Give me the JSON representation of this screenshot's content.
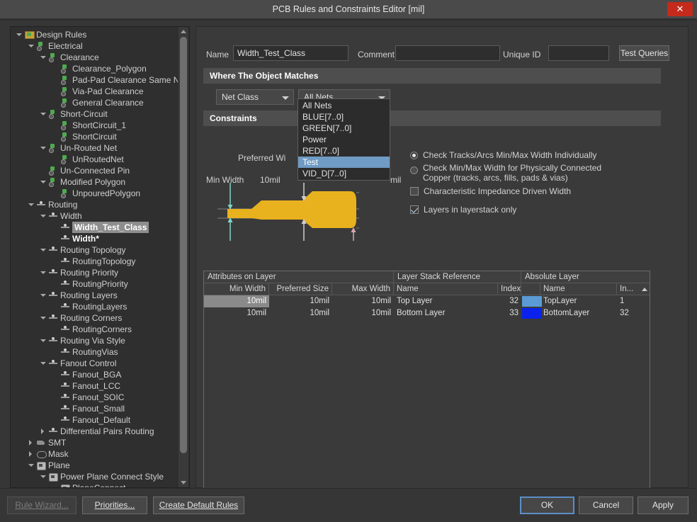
{
  "window": {
    "title": "PCB Rules and Constraints Editor [mil]",
    "close_label": "✕",
    "close_icon": "close-icon",
    "accent_close": "#c42b1c"
  },
  "tree": {
    "scrollbar": {
      "up_icon": "chevron-up-icon",
      "down_icon": "chevron-down-icon"
    },
    "items": [
      {
        "label": "Design Rules",
        "depth": 0,
        "twist": "down",
        "icon": "folder-rules-icon",
        "iconclass": "ic-folder"
      },
      {
        "label": "Electrical",
        "depth": 1,
        "twist": "down",
        "icon": "electrical-icon",
        "iconclass": "ic-elec"
      },
      {
        "label": "Clearance",
        "depth": 2,
        "twist": "down",
        "icon": "electrical-icon",
        "iconclass": "ic-elec"
      },
      {
        "label": "Clearance_Polygon",
        "depth": 3,
        "twist": "none",
        "icon": "electrical-icon",
        "iconclass": "ic-elec"
      },
      {
        "label": "Pad-Pad Clearance Same Ne",
        "depth": 3,
        "twist": "none",
        "icon": "electrical-icon",
        "iconclass": "ic-elec"
      },
      {
        "label": "Via-Pad Clearance",
        "depth": 3,
        "twist": "none",
        "icon": "electrical-icon",
        "iconclass": "ic-elec"
      },
      {
        "label": "General Clearance",
        "depth": 3,
        "twist": "none",
        "icon": "electrical-icon",
        "iconclass": "ic-elec"
      },
      {
        "label": "Short-Circuit",
        "depth": 2,
        "twist": "down",
        "icon": "electrical-icon",
        "iconclass": "ic-elec"
      },
      {
        "label": "ShortCircuit_1",
        "depth": 3,
        "twist": "none",
        "icon": "electrical-icon",
        "iconclass": "ic-elec"
      },
      {
        "label": "ShortCircuit",
        "depth": 3,
        "twist": "none",
        "icon": "electrical-icon",
        "iconclass": "ic-elec"
      },
      {
        "label": "Un-Routed Net",
        "depth": 2,
        "twist": "down",
        "icon": "electrical-icon",
        "iconclass": "ic-elec"
      },
      {
        "label": "UnRoutedNet",
        "depth": 3,
        "twist": "none",
        "icon": "electrical-icon",
        "iconclass": "ic-elec"
      },
      {
        "label": "Un-Connected Pin",
        "depth": 2,
        "twist": "none",
        "icon": "electrical-icon",
        "iconclass": "ic-elec"
      },
      {
        "label": "Modified Polygon",
        "depth": 2,
        "twist": "down",
        "icon": "electrical-icon",
        "iconclass": "ic-elec"
      },
      {
        "label": "UnpouredPolygon",
        "depth": 3,
        "twist": "none",
        "icon": "electrical-icon",
        "iconclass": "ic-elec"
      },
      {
        "label": "Routing",
        "depth": 1,
        "twist": "down",
        "icon": "routing-icon",
        "iconclass": "ic-route"
      },
      {
        "label": "Width",
        "depth": 2,
        "twist": "down",
        "icon": "routing-icon",
        "iconclass": "ic-route"
      },
      {
        "label": "Width_Test_Class",
        "depth": 3,
        "twist": "none",
        "icon": "routing-icon",
        "iconclass": "ic-route",
        "selected": true
      },
      {
        "label": "Width*",
        "depth": 3,
        "twist": "none",
        "icon": "routing-icon",
        "iconclass": "ic-route",
        "bold": true
      },
      {
        "label": "Routing Topology",
        "depth": 2,
        "twist": "down",
        "icon": "routing-icon",
        "iconclass": "ic-route"
      },
      {
        "label": "RoutingTopology",
        "depth": 3,
        "twist": "none",
        "icon": "routing-icon",
        "iconclass": "ic-route"
      },
      {
        "label": "Routing Priority",
        "depth": 2,
        "twist": "down",
        "icon": "routing-icon",
        "iconclass": "ic-route"
      },
      {
        "label": "RoutingPriority",
        "depth": 3,
        "twist": "none",
        "icon": "routing-icon",
        "iconclass": "ic-route"
      },
      {
        "label": "Routing Layers",
        "depth": 2,
        "twist": "down",
        "icon": "routing-icon",
        "iconclass": "ic-route"
      },
      {
        "label": "RoutingLayers",
        "depth": 3,
        "twist": "none",
        "icon": "routing-icon",
        "iconclass": "ic-route"
      },
      {
        "label": "Routing Corners",
        "depth": 2,
        "twist": "down",
        "icon": "routing-icon",
        "iconclass": "ic-route"
      },
      {
        "label": "RoutingCorners",
        "depth": 3,
        "twist": "none",
        "icon": "routing-icon",
        "iconclass": "ic-route"
      },
      {
        "label": "Routing Via Style",
        "depth": 2,
        "twist": "down",
        "icon": "routing-icon",
        "iconclass": "ic-route"
      },
      {
        "label": "RoutingVias",
        "depth": 3,
        "twist": "none",
        "icon": "routing-icon",
        "iconclass": "ic-route"
      },
      {
        "label": "Fanout Control",
        "depth": 2,
        "twist": "down",
        "icon": "routing-icon",
        "iconclass": "ic-route"
      },
      {
        "label": "Fanout_BGA",
        "depth": 3,
        "twist": "none",
        "icon": "routing-icon",
        "iconclass": "ic-route"
      },
      {
        "label": "Fanout_LCC",
        "depth": 3,
        "twist": "none",
        "icon": "routing-icon",
        "iconclass": "ic-route"
      },
      {
        "label": "Fanout_SOIC",
        "depth": 3,
        "twist": "none",
        "icon": "routing-icon",
        "iconclass": "ic-route"
      },
      {
        "label": "Fanout_Small",
        "depth": 3,
        "twist": "none",
        "icon": "routing-icon",
        "iconclass": "ic-route"
      },
      {
        "label": "Fanout_Default",
        "depth": 3,
        "twist": "none",
        "icon": "routing-icon",
        "iconclass": "ic-route"
      },
      {
        "label": "Differential Pairs Routing",
        "depth": 2,
        "twist": "right",
        "icon": "routing-icon",
        "iconclass": "ic-route"
      },
      {
        "label": "SMT",
        "depth": 1,
        "twist": "right",
        "icon": "smt-icon",
        "iconclass": "ic-smt"
      },
      {
        "label": "Mask",
        "depth": 1,
        "twist": "right",
        "icon": "mask-icon",
        "iconclass": "ic-mask"
      },
      {
        "label": "Plane",
        "depth": 1,
        "twist": "down",
        "icon": "plane-icon",
        "iconclass": "ic-plane"
      },
      {
        "label": "Power Plane Connect Style",
        "depth": 2,
        "twist": "down",
        "icon": "plane-icon",
        "iconclass": "ic-plane"
      },
      {
        "label": "PlaneConnect",
        "depth": 3,
        "twist": "none",
        "icon": "plane-icon",
        "iconclass": "ic-plane"
      }
    ]
  },
  "form": {
    "name_label": "Name",
    "name_value": "Width_Test_Class",
    "comment_label": "Comment",
    "comment_value": "",
    "unique_id_label": "Unique ID",
    "unique_id_value": "",
    "test_queries_label": "Test Queries"
  },
  "where_section": {
    "title": "Where The Object Matches",
    "scope_combo": {
      "value": "Net Class",
      "icon": "chevron-down-icon"
    },
    "netclass_combo": {
      "value": "All Nets",
      "icon": "chevron-down-icon"
    },
    "dropdown_open": true,
    "dropdown_items": [
      {
        "label": "All Nets",
        "highlighted": false
      },
      {
        "label": "BLUE[7..0]",
        "highlighted": false
      },
      {
        "label": "GREEN[7..0]",
        "highlighted": false
      },
      {
        "label": "Power",
        "highlighted": false
      },
      {
        "label": "RED[7..0]",
        "highlighted": false
      },
      {
        "label": "Test",
        "highlighted": true
      },
      {
        "label": "VID_D[7..0]",
        "highlighted": false
      }
    ]
  },
  "constraints": {
    "title": "Constraints",
    "preferred_width_label": "Preferred Wi",
    "min_width_label": "Min Width",
    "min_width_value": "10mil",
    "max_width_unit": "mil",
    "track_color": "#e8b11e",
    "options": [
      {
        "label": "Check Tracks/Arcs Min/Max Width Individually",
        "type": "radio",
        "checked": true
      },
      {
        "label": "Check Min/Max Width for Physically Connected\nCopper (tracks, arcs, fills, pads & vias)",
        "type": "radio",
        "checked": false
      },
      {
        "label": "Characteristic Impedance Driven Width",
        "type": "checkbox",
        "checked": false
      },
      {
        "label": "Layers in layerstack only",
        "type": "checkbox",
        "checked": true
      }
    ]
  },
  "table": {
    "group_headers": [
      "Attributes on Layer",
      "Layer Stack Reference",
      "Absolute Layer"
    ],
    "columns": [
      "Min Width",
      "Preferred Size",
      "Max Width",
      "Name",
      "Index",
      "",
      "Name",
      "In..."
    ],
    "sort_column": "In...",
    "sort_dir": "asc",
    "rows": [
      {
        "min_width": "10mil",
        "preferred_size": "10mil",
        "max_width": "10mil",
        "ls_name": "Top Layer",
        "ls_index": "32",
        "color": "#5b9bd5",
        "abs_name": "TopLayer",
        "abs_index": "1",
        "selected": true
      },
      {
        "min_width": "10mil",
        "preferred_size": "10mil",
        "max_width": "10mil",
        "ls_name": "Bottom Layer",
        "ls_index": "33",
        "color": "#0a22ec",
        "abs_name": "BottomLayer",
        "abs_index": "32",
        "selected": false
      }
    ]
  },
  "footer": {
    "rule_wizard": {
      "label": "Rule Wizard...",
      "disabled": true
    },
    "priorities": {
      "label": "Priorities...",
      "disabled": false
    },
    "create_default_rules": {
      "label": "Create Default Rules",
      "disabled": false
    },
    "ok": {
      "label": "OK",
      "default": true
    },
    "cancel": {
      "label": "Cancel"
    },
    "apply": {
      "label": "Apply"
    }
  }
}
